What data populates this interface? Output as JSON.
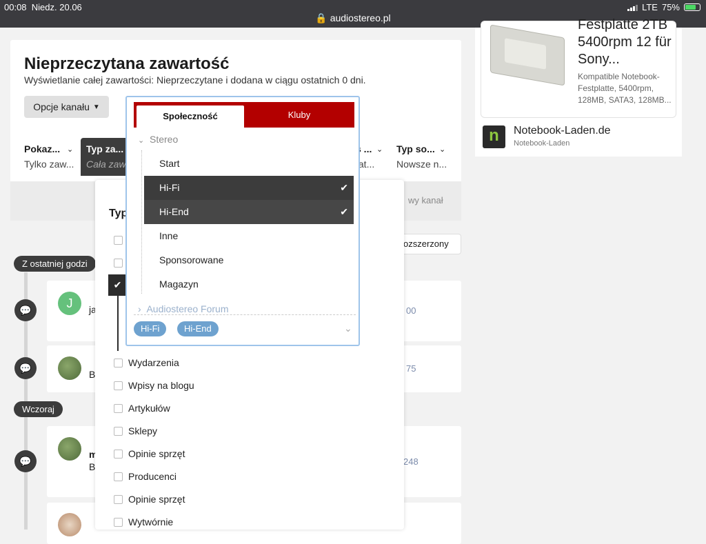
{
  "statusbar": {
    "time": "00:08",
    "date": "Niedz. 20.06",
    "url": "audiostereo.pl",
    "network": "LTE",
    "battery": "75%"
  },
  "page": {
    "title": "Nieprzeczytana zawartość",
    "description": "Wyświetlanie całej zawartości: Nieprzeczytane i dodana w ciągu ostatnich 0 dni.",
    "options_button": "Opcje kanału"
  },
  "filters": [
    {
      "title": "Pokaz...",
      "value": "Tylko zaw..."
    },
    {
      "title": "Typ za...",
      "value": "Cała zaw..."
    },
    {
      "title": "s ...",
      "value": "tat..."
    },
    {
      "title": "Typ so...",
      "value": "Nowsze n..."
    }
  ],
  "buttons": {
    "new_feed": "wy kanał",
    "advanced": "ozszerzony"
  },
  "timeline": {
    "groups": [
      "Z ostatniej godzi",
      "Wczoraj"
    ],
    "items": [
      {
        "avatar_letter": "J",
        "line1": "ja",
        "number": "00"
      },
      {
        "line1": "B",
        "number": "75"
      },
      {
        "line1": "m",
        "line2": "B",
        "number": "248"
      }
    ]
  },
  "type_panel": {
    "heading": "Typ",
    "options": [
      "Wydarzenia",
      "Wpisy na blogu",
      "Artykułów",
      "Sklepy",
      "Opinie sprzęt",
      "Producenci",
      "Opinie sprzęt",
      "Wytwórnie"
    ]
  },
  "dropdown": {
    "tabs": [
      "Społeczność",
      "Kluby"
    ],
    "group": "Stereo",
    "items": [
      {
        "label": "Start",
        "selected": false
      },
      {
        "label": "Hi-Fi",
        "selected": true
      },
      {
        "label": "Hi-End",
        "selected": true
      },
      {
        "label": "Inne",
        "selected": false
      },
      {
        "label": "Sponsorowane",
        "selected": false
      },
      {
        "label": "Magazyn",
        "selected": false
      }
    ],
    "next_group": "Audiostereo Forum",
    "chips": [
      "Hi-Fi",
      "Hi-End"
    ]
  },
  "ad": {
    "title": "Festplatte 2TB 5400rpm 12 für Sony...",
    "description": "Kompatible Notebook-Festplatte, 5400rpm, 128MB, SATA3, 128MB...",
    "advertiser": "Notebook-Laden.de",
    "advertiser_sub": "Notebook-Laden",
    "logo_letter": "n"
  },
  "colors": {
    "accent": "#b30000",
    "dark": "#3c3c3c",
    "chip": "#6ea2cf",
    "focus": "#9ec4ea"
  }
}
